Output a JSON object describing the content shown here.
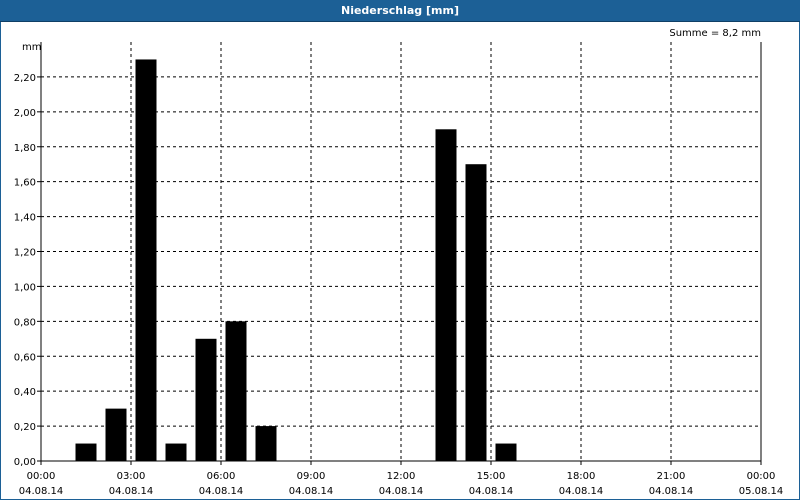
{
  "window": {
    "title": "Niederschlag [mm]"
  },
  "chart_data": {
    "type": "bar",
    "title": "Niederschlag [mm]",
    "ylabel": "mm",
    "annotation": "Summe = 8,2 mm",
    "ylim": [
      0,
      2.4
    ],
    "yticks": [
      "0,00",
      "0,20",
      "0,40",
      "0,60",
      "0,80",
      "1,00",
      "1,20",
      "1,40",
      "1,60",
      "1,80",
      "2,00",
      "2,20"
    ],
    "xlim_hours": [
      0,
      24
    ],
    "xticks": [
      {
        "time": "00:00",
        "date": "04.08.14"
      },
      {
        "time": "03:00",
        "date": "04.08.14"
      },
      {
        "time": "06:00",
        "date": "04.08.14"
      },
      {
        "time": "09:00",
        "date": "04.08.14"
      },
      {
        "time": "12:00",
        "date": "04.08.14"
      },
      {
        "time": "15:00",
        "date": "04.08.14"
      },
      {
        "time": "18:00",
        "date": "04.08.14"
      },
      {
        "time": "21:00",
        "date": "04.08.14"
      },
      {
        "time": "00:00",
        "date": "05.08.14"
      }
    ],
    "bars": [
      {
        "hour": 1.5,
        "value": 0.1
      },
      {
        "hour": 2.5,
        "value": 0.3
      },
      {
        "hour": 3.5,
        "value": 2.3
      },
      {
        "hour": 4.5,
        "value": 0.1
      },
      {
        "hour": 5.5,
        "value": 0.7
      },
      {
        "hour": 6.5,
        "value": 0.8
      },
      {
        "hour": 7.5,
        "value": 0.2
      },
      {
        "hour": 13.5,
        "value": 1.9
      },
      {
        "hour": 14.5,
        "value": 1.7
      },
      {
        "hour": 15.5,
        "value": 0.1
      }
    ],
    "grid": true,
    "bar_color": "#000000"
  }
}
